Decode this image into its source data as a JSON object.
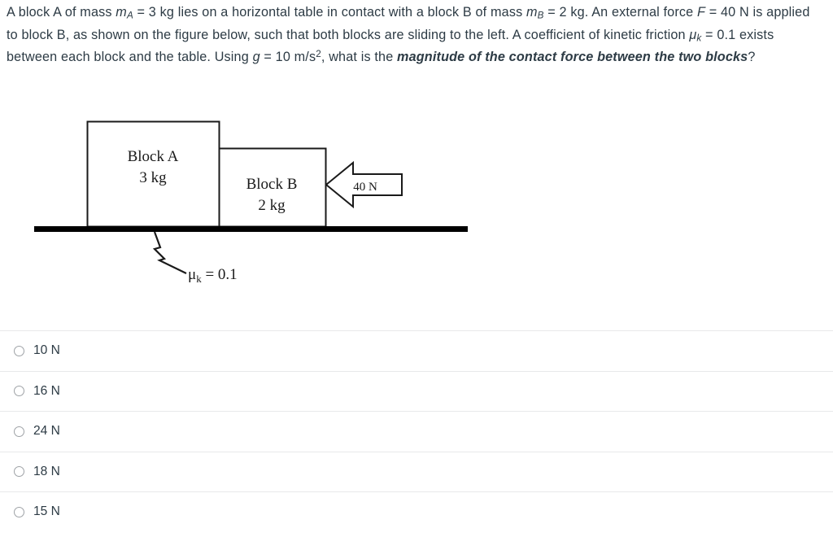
{
  "question": {
    "line1_a": "A block A of mass ",
    "sym_mA": "m",
    "sub_A": "A",
    "line1_b": " = 3 kg lies on a horizontal table in contact with a block B of mass ",
    "sym_mB": "m",
    "sub_B": "B",
    "line1_c": " = 2 kg. An external force ",
    "sym_F": "F",
    "line2_b": " = 40 N is applied to block B, as shown on the figure below, such that both blocks are sliding to the left. A coefficient of kinetic friction ",
    "sym_mu": "μ",
    "sub_k": "k",
    "line3_b": " = 0.1 exists between each block and the table. Using ",
    "sym_g": "g",
    "line3_c": " = 10 m/s",
    "sup_2": "2",
    "line3_d": ", what is the ",
    "emphasis": "magnitude of the contact force between the two blocks",
    "line4_end": "?"
  },
  "figure": {
    "block_a_label": "Block A",
    "block_a_mass": "3 kg",
    "block_b_label": "Block B",
    "block_b_mass": "2 kg",
    "force_label": "40 N",
    "friction_symbol": "μ",
    "friction_subscript": "k",
    "friction_value": "= 0.1",
    "ground_color": "#000000",
    "outline_color": "#1a1a1a",
    "fill_color": "#ffffff"
  },
  "options": [
    {
      "label": "10 N",
      "selected": false
    },
    {
      "label": "16 N",
      "selected": false
    },
    {
      "label": "24 N",
      "selected": false
    },
    {
      "label": "18 N",
      "selected": false
    },
    {
      "label": "15 N",
      "selected": false
    }
  ],
  "colors": {
    "text": "#2d3b45",
    "separator": "#e8e9ea",
    "radio_border": "#9ea2a6",
    "background": "#ffffff"
  }
}
